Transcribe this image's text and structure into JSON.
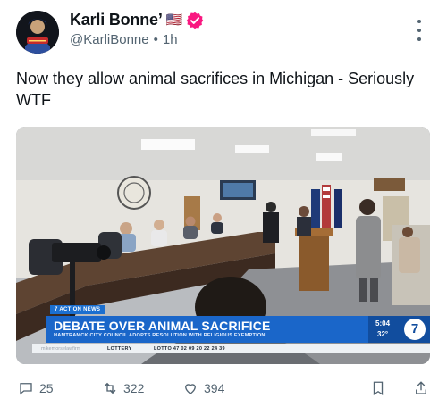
{
  "author": {
    "display_name": "Karli Bonne’",
    "flag": "🇺🇸",
    "handle": "@KarliBonne",
    "separator": "•",
    "time": "1h"
  },
  "post": {
    "text": "Now they allow animal sacrifices in Michigan - Seriously WTF"
  },
  "video": {
    "tag": "7 ACTION NEWS",
    "headline": "DEBATE OVER ANIMAL SACRIFICE",
    "subheadline": "HAMTRAMCK CITY COUNCIL ADOPTS RESOLUTION WITH RELIGIOUS EXEMPTION",
    "time": "5:04",
    "temperature": "32°",
    "station_logo": "7",
    "ticker_source": "mikemorselawfirm",
    "ticker_label": "LOTTERY",
    "ticker_numbers": "LOTTO 47  02  09  20  22  24  39"
  },
  "actions": {
    "reply_count": "25",
    "repost_count": "322",
    "like_count": "394"
  },
  "colors": {
    "accent": "#1d9bf0",
    "news_blue": "#1a66c9",
    "verified_badge": "#f91880",
    "text_secondary": "#536471"
  }
}
